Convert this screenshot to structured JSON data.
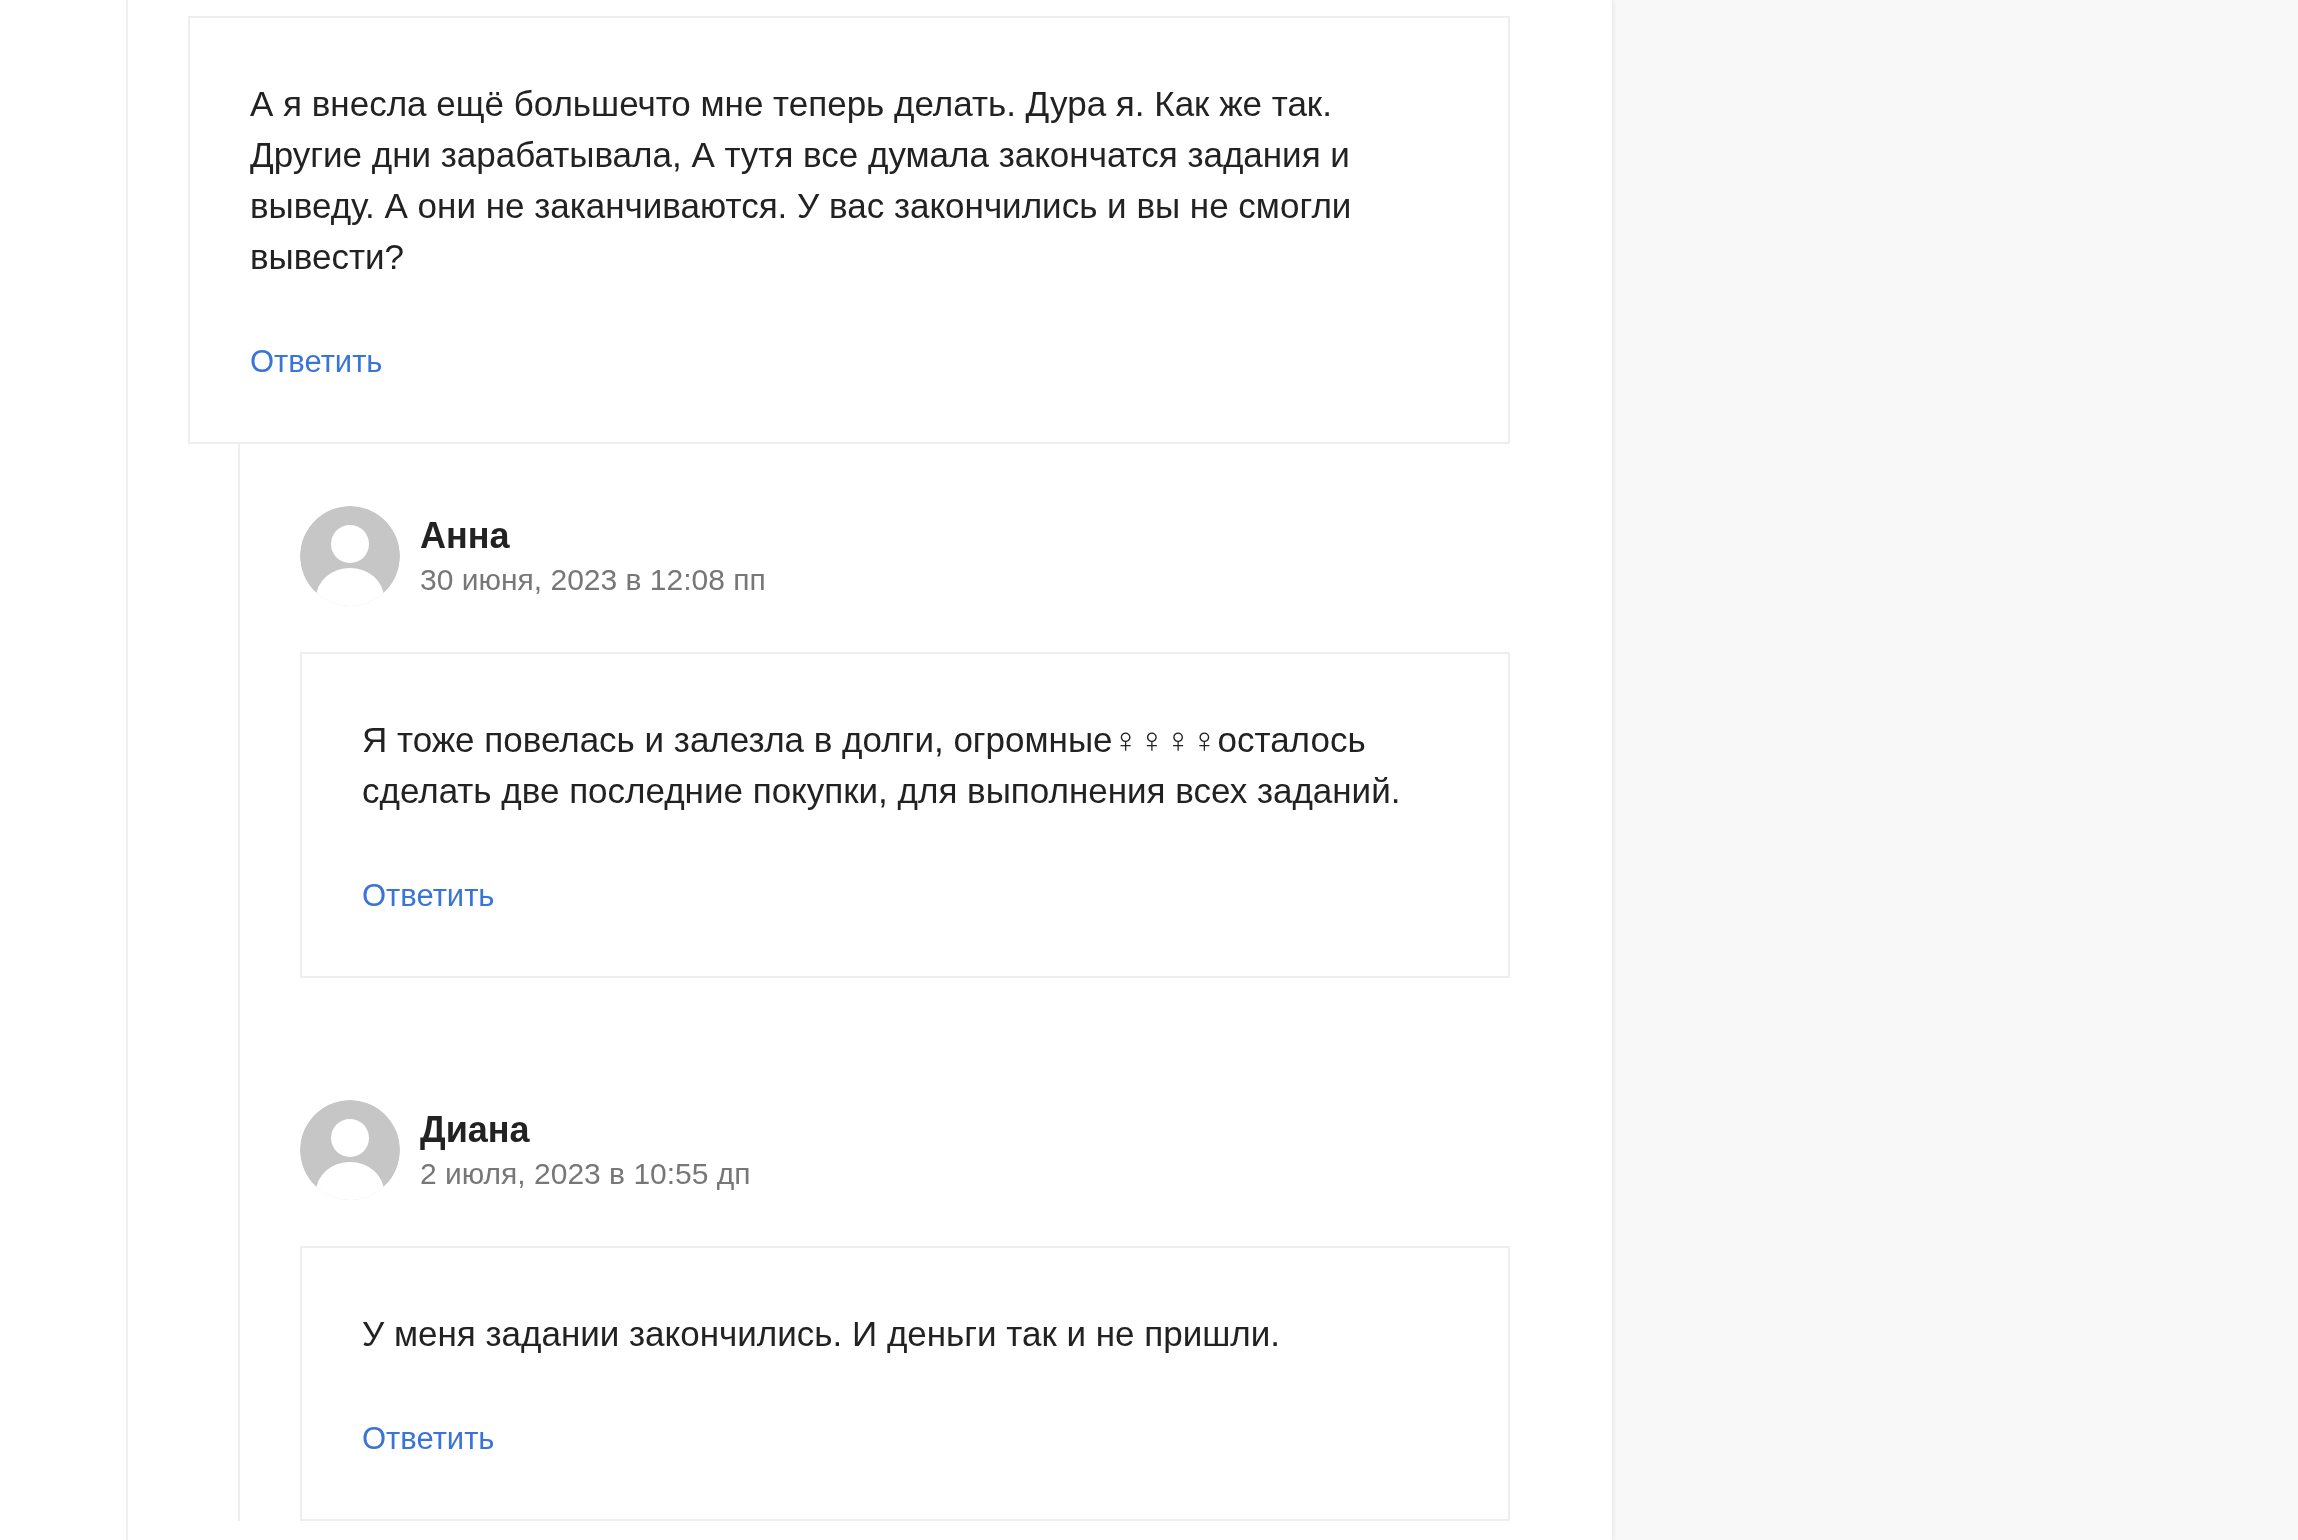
{
  "comments": [
    {
      "text": "А я внесла ещё большечто мне теперь делать. Дура я. Как же так. Другие дни зарабатывала, А тутя все думала закончатся задания и выведу. А они не заканчиваются. У вас закончились и вы не смогли вывести?",
      "reply_label": "Ответить",
      "children": [
        {
          "author": "Анна",
          "date": "30 июня, 2023 в 12:08 пп",
          "text": "Я тоже повелась и залезла в долги, огромные♀♀♀♀осталось сделать две последние покупки, для выполнения всех заданий.",
          "reply_label": "Ответить"
        },
        {
          "author": "Диана",
          "date": "2 июля, 2023 в 10:55 дп",
          "text": "У меня задании закончились. И деньги так и не пришли.",
          "reply_label": "Ответить"
        }
      ]
    }
  ]
}
